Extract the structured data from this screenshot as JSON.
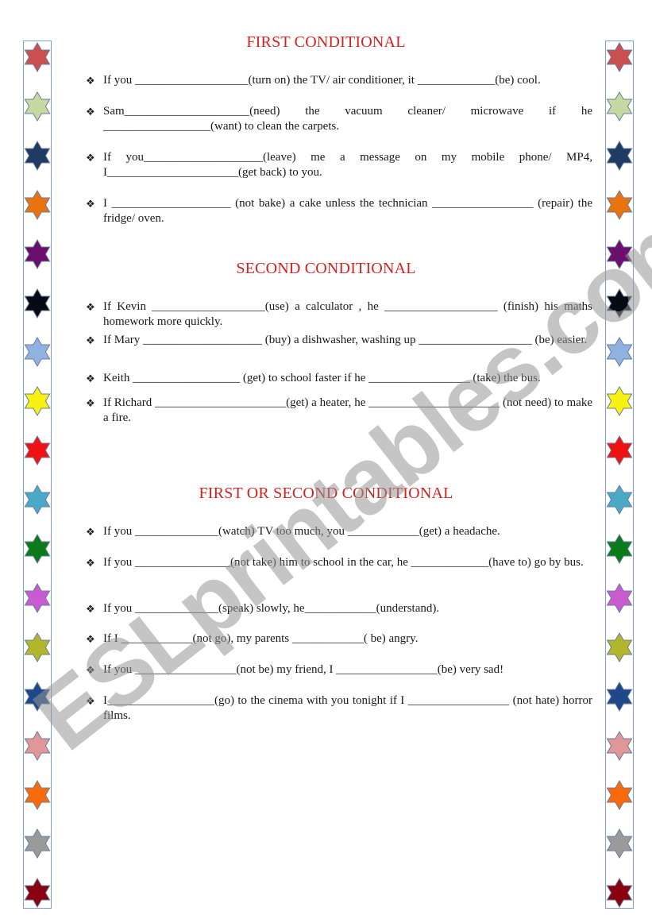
{
  "sections": [
    {
      "title": "FIRST CONDITIONAL",
      "items": [
        "If you ___________________(turn on) the TV/ air conditioner, it _____________(be) cool.",
        "Sam_____________________(need) the vacuum cleaner/ microwave if he __________________(want) to clean the carpets.",
        "If you____________________(leave) me a message on my mobile phone/ MP4, I______________________(get back) to you.",
        "I ____________________ (not bake) a cake unless the technician _________________ (repair) the fridge/ oven."
      ]
    },
    {
      "title": "SECOND CONDITIONAL",
      "items": [
        "If Kevin ___________________(use) a calculator , he ___________________ (finish) his maths homework more quickly.",
        "If Mary ____________________ (buy) a dishwasher, washing up ___________________ (be) easier.",
        "Keith __________________ (get) to school faster if he _________________ (take) the bus.",
        "If Richard ______________________(get) a heater, he ______________________ (not need) to make a fire."
      ]
    },
    {
      "title": "FIRST OR SECOND CONDITIONAL",
      "items": [
        "If you ______________(watch) TV too much, you ____________(get) a headache.",
        "If you ________________(not take) him to school in the car, he _____________(have to) go by bus.",
        "If you ______________(speak) slowly, he____________(understand).",
        "If I ____________(not go), my parents ____________( be) angry.",
        "If you _________________(not be) my friend, I _________________(be) very sad!",
        "I__________________(go) to the cinema with you tonight if I _________________ (not hate) horror films."
      ]
    }
  ],
  "bullet_icon": "❖",
  "watermark": "ESLprintables.com",
  "colors": {
    "title": "#d61f1f",
    "border": "#7f9fd0",
    "stars": [
      "#c9504e",
      "#c5d9a0",
      "#1f3a63",
      "#e8730f",
      "#6b0f6e",
      "#050a14",
      "#8fb2e0",
      "#f7f20f",
      "#f01212",
      "#4ba9c8",
      "#0a7a1a",
      "#c85bd0",
      "#b2b62a",
      "#1e4887",
      "#e19698",
      "#fa6a0a",
      "#9a9a9a",
      "#8a0010"
    ]
  }
}
